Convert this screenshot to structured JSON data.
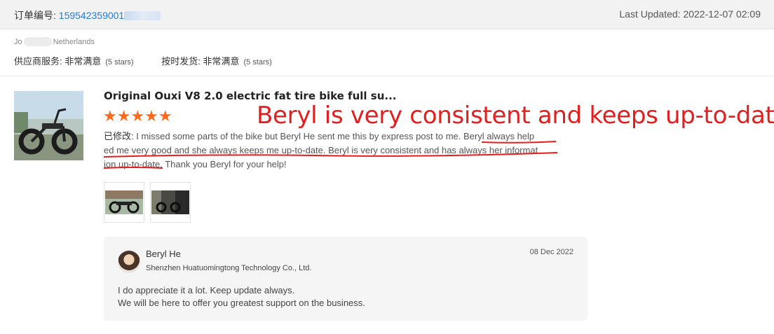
{
  "header": {
    "order_label": "订单编号: ",
    "order_number": "159542359001",
    "last_updated": "Last Updated: 2022-12-07 02:09"
  },
  "buyer": {
    "name_prefix": "Jo",
    "country": "Netherlands",
    "supplier_service_label": "供应商服务: 非常满意",
    "supplier_service_stars": "(5 stars)",
    "shipping_label": "按时发货: 非常满意",
    "shipping_stars": "(5 stars)"
  },
  "review": {
    "product_title": "Original Ouxi V8 2.0 electric fat tire bike full su...",
    "rating": 5,
    "stars_glyph": "★★★★★",
    "edited_label": "已修改:",
    "text_line1": " I missed some parts of the bike but Beryl He sent me this by express post to me. Beryl always help",
    "text_line2": "ed me very good and she always keeps me up-to-date. Beryl is very consistent and has always her informat",
    "text_line3": "ion up-to-date. Thank you Beryl for your help!",
    "annotation": "Beryl is very consistent and keeps up-to-date."
  },
  "reply": {
    "name": "Beryl He",
    "company": "Shenzhen Huatuomingtong Technology Co., Ltd.",
    "date": "08 Dec 2022",
    "line1": "I do appreciate it a lot.  Keep update always.",
    "line2": "We will be here to offer you greatest support on the business."
  },
  "colors": {
    "accent_blue": "#2a7ad2",
    "star_orange": "#ff6a1a",
    "annotation_red": "#e41e1e"
  }
}
